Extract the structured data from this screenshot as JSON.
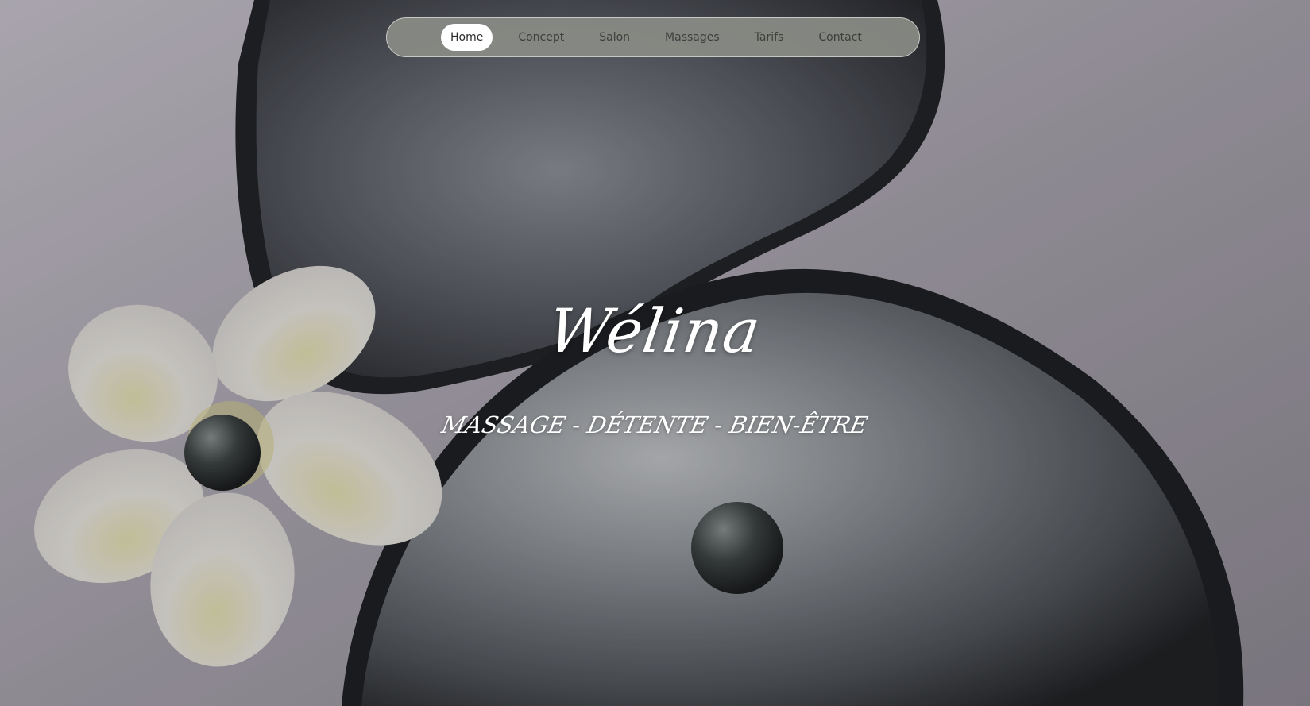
{
  "nav": {
    "items": [
      {
        "label": "Home",
        "active": true
      },
      {
        "label": "Concept",
        "active": false
      },
      {
        "label": "Salon",
        "active": false
      },
      {
        "label": "Massages",
        "active": false
      },
      {
        "label": "Tarifs",
        "active": false
      },
      {
        "label": "Contact",
        "active": false
      }
    ]
  },
  "hero": {
    "title": "Wélina",
    "tagline": "MASSAGE - DÉTENTE - BIEN-ÊTRE",
    "background": "hero-image-pearl-shells-frangipani"
  },
  "colors": {
    "nav_background": "#8a8c86",
    "nav_active_background": "#ffffff",
    "nav_text": "#3d3f3c",
    "title_text": "#ffffff"
  }
}
